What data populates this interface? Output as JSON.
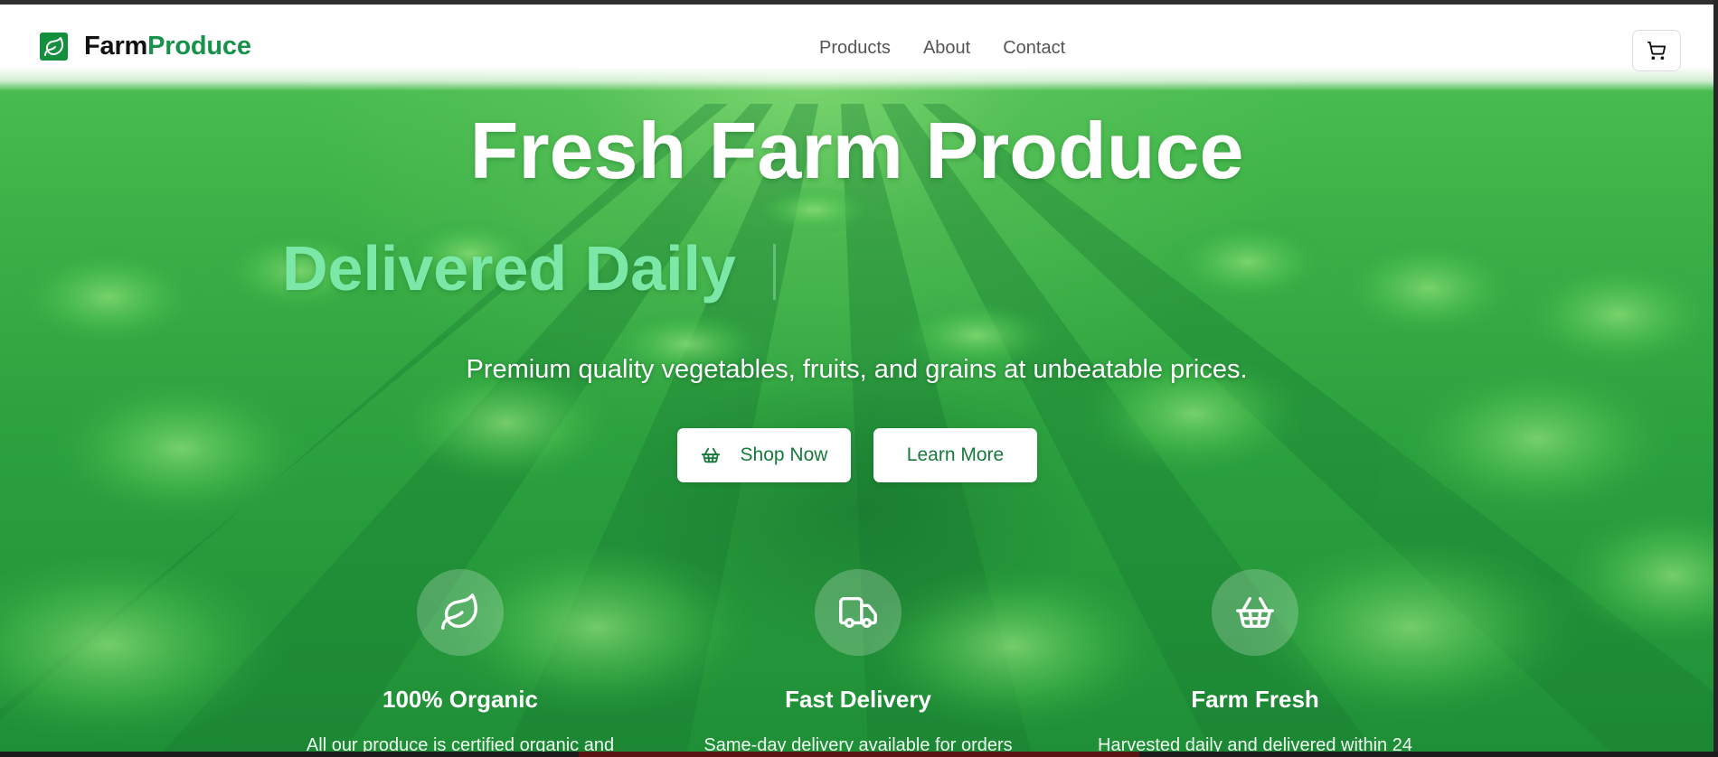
{
  "brand": {
    "name_part1": "Farm",
    "name_part2": "Produce",
    "logo_icon": "leaf-icon",
    "color": "#138f3e"
  },
  "nav": {
    "links": [
      {
        "label": "Products"
      },
      {
        "label": "About"
      },
      {
        "label": "Contact"
      }
    ],
    "cart_icon": "cart-icon"
  },
  "hero": {
    "title": "Fresh Farm Produce",
    "typed_text": "Delivered Daily",
    "subtitle": "Premium quality vegetables, fruits, and grains at unbeatable prices.",
    "primary_button": {
      "label": "Shop Now",
      "icon": "basket-icon"
    },
    "secondary_button": {
      "label": "Learn More"
    }
  },
  "features": [
    {
      "icon": "leaf-icon",
      "title": "100% Organic",
      "description": "All our produce is certified organic and"
    },
    {
      "icon": "truck-icon",
      "title": "Fast Delivery",
      "description": "Same-day delivery available for orders"
    },
    {
      "icon": "basket-icon",
      "title": "Farm Fresh",
      "description": "Harvested daily and delivered within 24"
    }
  ],
  "colors": {
    "accent_green": "#16924a",
    "typed_green": "#7be8a8",
    "hero_green": "#2da23f"
  }
}
